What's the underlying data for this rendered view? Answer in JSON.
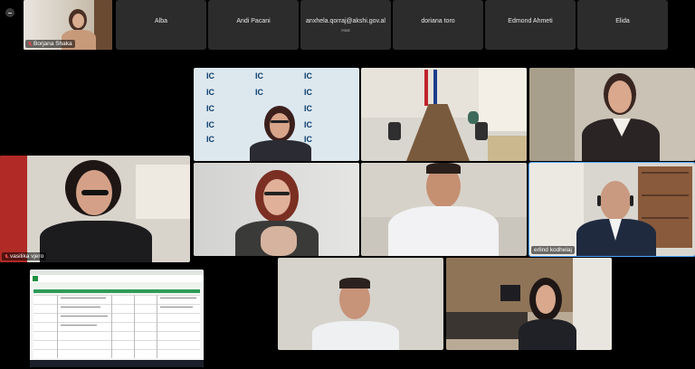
{
  "toolbar": {
    "collapse_icon": "minimize-icon"
  },
  "self_view": {
    "name": "Borjana Shaka",
    "muted": true
  },
  "top_strip": [
    {
      "name": "Alba",
      "sub": ""
    },
    {
      "name": "Andi Pacani",
      "sub": ""
    },
    {
      "name": "anxhela.qorraj@akshi.gov.al",
      "sub": "Host"
    },
    {
      "name": "doriana toro",
      "sub": ""
    },
    {
      "name": "Edmond Ahmeti",
      "sub": ""
    },
    {
      "name": "Elida",
      "sub": ""
    }
  ],
  "video_labels": {
    "vasilika": "vasilika vjero",
    "erlind": "erlind kodhelaj"
  },
  "colors": {
    "active_speaker": "#4aa3ff",
    "muted_icon": "#e04545",
    "ic_blue": "#0a3b6b"
  }
}
